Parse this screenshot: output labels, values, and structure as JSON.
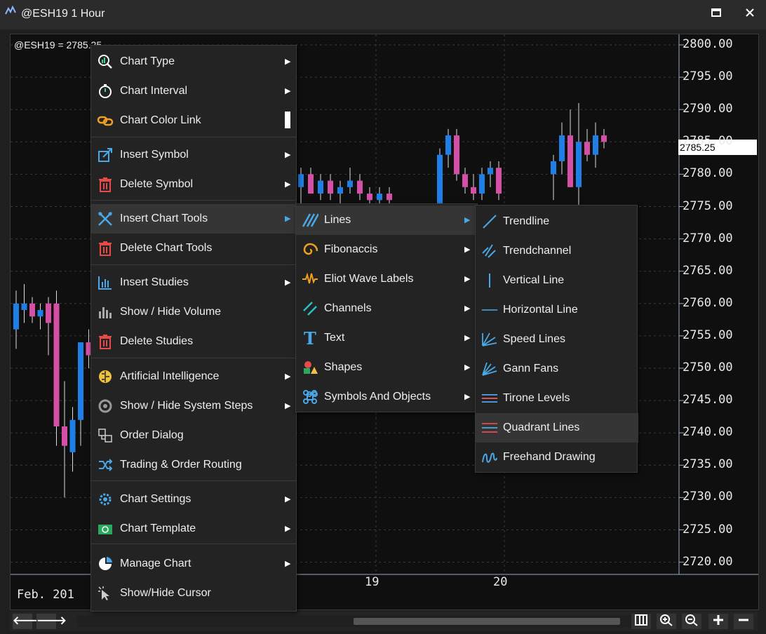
{
  "window": {
    "title": "@ESH19 1 Hour",
    "icon": "chart-app-icon",
    "maximize_glyph": "🗖",
    "close_glyph": "✕"
  },
  "chart": {
    "symbol_label": "@ESH19 = 2785.25",
    "last_price_tag": "2785.25",
    "y_axis_ticks": [
      "2800.00",
      "2795.00",
      "2790.00",
      "2785.00",
      "2780.00",
      "2775.00",
      "2770.00",
      "2765.00",
      "2760.00",
      "2755.00",
      "2750.00",
      "2745.00",
      "2740.00",
      "2735.00",
      "2730.00",
      "2725.00",
      "2720.00"
    ],
    "x_axis_dates": [
      "Feb. 201",
      "19",
      "20"
    ],
    "up_color": "#1e7fe6",
    "down_color": "#d64fa6"
  },
  "chart_data": {
    "type": "candlestick",
    "ylim": [
      2718,
      2802
    ],
    "y_ticks": [
      2800,
      2795,
      2790,
      2785,
      2780,
      2775,
      2770,
      2765,
      2760,
      2755,
      2750,
      2745,
      2740,
      2735,
      2730,
      2725,
      2720
    ],
    "candles": [
      {
        "o": 2756,
        "h": 2762,
        "l": 2753,
        "c": 2760,
        "d": "up"
      },
      {
        "o": 2759,
        "h": 2763,
        "l": 2757,
        "c": 2760,
        "d": "up"
      },
      {
        "o": 2760,
        "h": 2761,
        "l": 2757,
        "c": 2758,
        "d": "down"
      },
      {
        "o": 2758,
        "h": 2760,
        "l": 2756,
        "c": 2759,
        "d": "up"
      },
      {
        "o": 2760,
        "h": 2761,
        "l": 2752,
        "c": 2757,
        "d": "down"
      },
      {
        "o": 2760,
        "h": 2762,
        "l": 2738,
        "c": 2741,
        "d": "down"
      },
      {
        "o": 2741,
        "h": 2748,
        "l": 2730,
        "c": 2738,
        "d": "down"
      },
      {
        "o": 2737,
        "h": 2744,
        "l": 2734,
        "c": 2742,
        "d": "up"
      },
      {
        "o": 2742,
        "h": 2754,
        "l": 2738,
        "c": 2754,
        "d": "up"
      },
      {
        "o": 2754,
        "h": 2756,
        "l": 2750,
        "c": 2752,
        "d": "down"
      }
    ]
  },
  "context_menu": {
    "items": [
      {
        "label": "Chart Type",
        "icon": "chart-type-icon",
        "has_submenu": true
      },
      {
        "label": "Chart Interval",
        "icon": "stopwatch-icon",
        "has_submenu": true
      },
      {
        "label": "Chart Color Link",
        "icon": "link-icon",
        "has_submenu": false
      },
      {
        "label": "Insert Symbol",
        "icon": "insert-symbol-icon",
        "has_submenu": true
      },
      {
        "label": "Delete Symbol",
        "icon": "trash-icon",
        "has_submenu": true
      },
      {
        "label": "Insert Chart Tools",
        "icon": "chart-tools-icon",
        "has_submenu": true
      },
      {
        "label": "Delete Chart Tools",
        "icon": "trash-icon",
        "has_submenu": false
      },
      {
        "label": "Insert Studies",
        "icon": "studies-icon",
        "has_submenu": true
      },
      {
        "label": "Show / Hide Volume",
        "icon": "volume-icon",
        "has_submenu": false
      },
      {
        "label": "Delete Studies",
        "icon": "trash-icon",
        "has_submenu": false
      },
      {
        "label": "Artificial Intelligence",
        "icon": "brain-icon",
        "has_submenu": true
      },
      {
        "label": "Show / Hide System Steps",
        "icon": "system-steps-icon",
        "has_submenu": true
      },
      {
        "label": "Order Dialog",
        "icon": "order-dialog-icon",
        "has_submenu": false
      },
      {
        "label": "Trading & Order Routing",
        "icon": "routing-icon",
        "has_submenu": false
      },
      {
        "label": "Chart Settings",
        "icon": "settings-icon",
        "has_submenu": true
      },
      {
        "label": "Chart Template",
        "icon": "template-icon",
        "has_submenu": true
      },
      {
        "label": "Manage Chart",
        "icon": "manage-chart-icon",
        "has_submenu": true
      },
      {
        "label": "Show/Hide Cursor",
        "icon": "cursor-icon",
        "has_submenu": false
      }
    ],
    "highlighted": "Insert Chart Tools"
  },
  "chart_tools_submenu": {
    "items": [
      {
        "label": "Lines",
        "icon": "lines-icon",
        "has_submenu": true
      },
      {
        "label": "Fibonaccis",
        "icon": "fibonacci-icon",
        "has_submenu": true
      },
      {
        "label": "Eliot Wave Labels",
        "icon": "wave-icon",
        "has_submenu": true
      },
      {
        "label": "Channels",
        "icon": "channels-icon",
        "has_submenu": true
      },
      {
        "label": "Text",
        "icon": "text-icon",
        "has_submenu": true
      },
      {
        "label": "Shapes",
        "icon": "shapes-icon",
        "has_submenu": true
      },
      {
        "label": "Symbols And Objects",
        "icon": "symbols-icon",
        "has_submenu": true
      }
    ],
    "highlighted": "Lines"
  },
  "lines_submenu": {
    "items": [
      {
        "label": "Trendline",
        "icon": "trendline-icon"
      },
      {
        "label": "Trendchannel",
        "icon": "trendchannel-icon"
      },
      {
        "label": "Vertical Line",
        "icon": "vertical-line-icon"
      },
      {
        "label": "Horizontal Line",
        "icon": "horizontal-line-icon"
      },
      {
        "label": "Speed Lines",
        "icon": "speed-lines-icon"
      },
      {
        "label": "Gann Fans",
        "icon": "gann-fans-icon"
      },
      {
        "label": "Tirone Levels",
        "icon": "tirone-levels-icon"
      },
      {
        "label": "Quadrant Lines",
        "icon": "quadrant-lines-icon"
      },
      {
        "label": "Freehand Drawing",
        "icon": "freehand-icon"
      }
    ],
    "highlighted": "Quadrant Lines"
  },
  "scrollbar": {
    "left_arrow": "🡐",
    "right_arrow": "🡒",
    "buttons": [
      "columns-icon",
      "zoom-in-icon",
      "zoom-out-icon",
      "plus-icon",
      "minus-icon"
    ]
  }
}
